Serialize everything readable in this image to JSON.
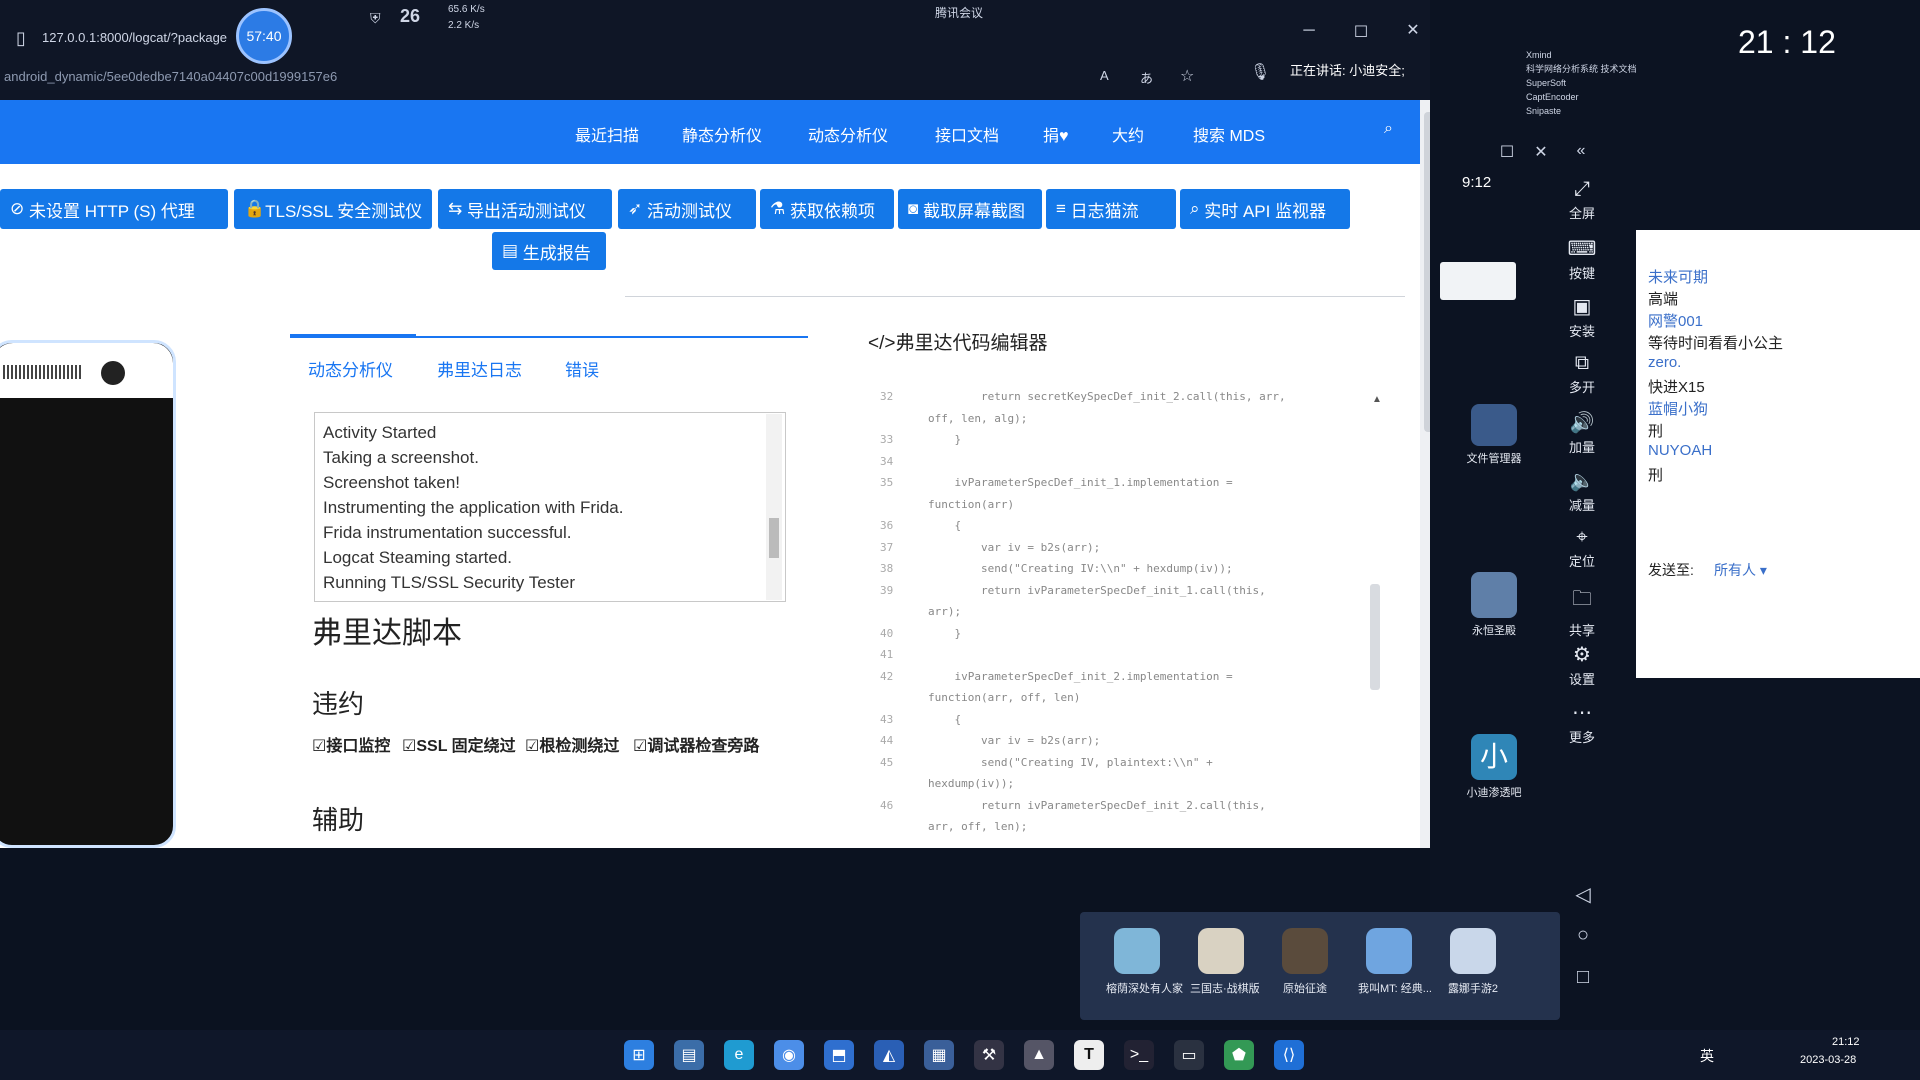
{
  "browser": {
    "url": "127.0.0.1:8000/logcat/?package",
    "timer": "57:40",
    "temp": "26",
    "net_up": "65.6 K/s",
    "net_down": "2.2 K/s",
    "meeting": "腾讯会议",
    "subpath": "android_dynamic/5ee0dedbe7140a04407c00d1999157e6",
    "speaking": "正在讲话: 小迪安全;"
  },
  "navbar": {
    "items": [
      "最近扫描",
      "静态分析仪",
      "动态分析仪",
      "接口文档",
      "捐♥",
      "大约",
      "搜索 MDS"
    ]
  },
  "toolbar": {
    "buttons": [
      "未设置 HTTP (S) 代理",
      "TLS/SSL 安全测试仪",
      "导出活动测试仪",
      "活动测试仪",
      "获取依赖项",
      "截取屏幕截图",
      "日志猫流",
      "实时 API 监视器"
    ],
    "report": "生成报告"
  },
  "tabs": [
    "动态分析仪",
    "弗里达日志",
    "错误"
  ],
  "log_lines": [
    "Activity Started",
    "Taking a screenshot.",
    "Screenshot taken!",
    "Instrumenting the application with Frida.",
    "Frida instrumentation successful.",
    "Logcat Steaming started.",
    "Running TLS/SSL Security Tester"
  ],
  "frida": {
    "heading": "弗里达脚本",
    "section_violation": "违约",
    "checkboxes": [
      "接口监控",
      "SSL 固定绕过",
      "根检测绕过",
      "调试器检查旁路"
    ],
    "section_aux": "辅助"
  },
  "editor": {
    "title": "弗里达代码编辑器",
    "lines": [
      {
        "n": "32",
        "code": "        return secretKeySpecDef_init_2.call(this, arr,"
      },
      {
        "n": "",
        "code": "off, len, alg);"
      },
      {
        "n": "33",
        "code": "    }"
      },
      {
        "n": "34",
        "code": ""
      },
      {
        "n": "35",
        "code": "    ivParameterSpecDef_init_1.implementation ="
      },
      {
        "n": "",
        "code": "function(arr)"
      },
      {
        "n": "36",
        "code": "    {"
      },
      {
        "n": "37",
        "code": "        var iv = b2s(arr);"
      },
      {
        "n": "38",
        "code": "        send(\"Creating IV:\\\\n\" + hexdump(iv));"
      },
      {
        "n": "39",
        "code": "        return ivParameterSpecDef_init_1.call(this,"
      },
      {
        "n": "",
        "code": "arr);"
      },
      {
        "n": "40",
        "code": "    }"
      },
      {
        "n": "41",
        "code": ""
      },
      {
        "n": "42",
        "code": "    ivParameterSpecDef_init_2.implementation ="
      },
      {
        "n": "",
        "code": "function(arr, off, len)"
      },
      {
        "n": "43",
        "code": "    {"
      },
      {
        "n": "44",
        "code": "        var iv = b2s(arr);"
      },
      {
        "n": "45",
        "code": "        send(\"Creating IV, plaintext:\\\\n\" +"
      },
      {
        "n": "",
        "code": "hexdump(iv));"
      },
      {
        "n": "46",
        "code": "        return ivParameterSpecDef_init_2.call(this,"
      },
      {
        "n": "",
        "code": "arr, off, len);"
      }
    ]
  },
  "emulator": {
    "status_time": "9:12",
    "tools": [
      "全屏",
      "按键",
      "安装",
      "多开",
      "加量",
      "减量",
      "定位",
      "共享",
      "设置",
      "更多"
    ],
    "apps": [
      "文件管理器",
      "永恒圣殿",
      "小迪渗透吧"
    ]
  },
  "clock": {
    "time": "21 : 12"
  },
  "recent_files": [
    "Xmind",
    "科学网络分析系统 技术文档",
    "SuperSoft",
    "CaptEncoder",
    "Snipaste"
  ],
  "chat": {
    "lines": [
      {
        "t": "未来可期",
        "c": "#3a6fc9"
      },
      {
        "t": "高端",
        "c": "#222"
      },
      {
        "t": "网警001",
        "c": "#3a6fc9"
      },
      {
        "t": "等待时间看看小公主",
        "c": "#222"
      },
      {
        "t": "zero.",
        "c": "#3a6fc9"
      },
      {
        "t": "快进X15",
        "c": "#222"
      },
      {
        "t": "蓝帽小狗",
        "c": "#3a6fc9"
      },
      {
        "t": "刑",
        "c": "#222"
      },
      {
        "t": "NUYOAH",
        "c": "#3a6fc9"
      },
      {
        "t": "刑",
        "c": "#222"
      }
    ],
    "send_to_label": "发送至:",
    "send_to_value": "所有人 ▾"
  },
  "dock": {
    "apps": [
      {
        "name": "榕荫深处有人家",
        "color": "#7fb6d8"
      },
      {
        "name": "三国志·战棋版",
        "color": "#d9d2c2"
      },
      {
        "name": "原始征途",
        "color": "#5a4b3c"
      },
      {
        "name": "我叫MT: 经典...",
        "color": "#6fa5e0"
      },
      {
        "name": "露娜手游2",
        "color": "#c9d7ea"
      }
    ]
  },
  "taskbar": {
    "lang": "英",
    "time": "21:12",
    "date": "2023-03-28"
  }
}
